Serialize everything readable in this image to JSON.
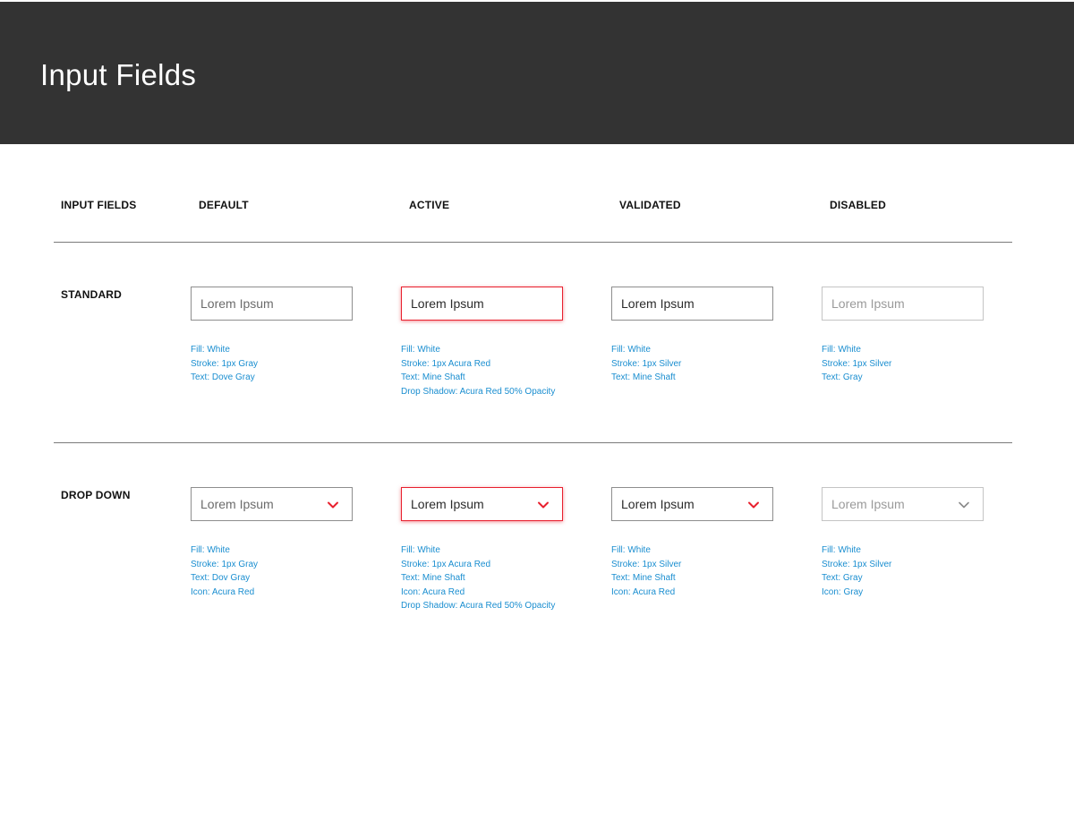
{
  "header": {
    "title": "Input Fields"
  },
  "columns": {
    "label": "INPUT FIELDS",
    "default": "DEFAULT",
    "active": "ACTIVE",
    "validated": "VALIDATED",
    "disabled": "DISABLED"
  },
  "colors": {
    "header_bg": "#333333",
    "acura_red": "#e8202e",
    "spec_text": "#1a8ed0",
    "gray_stroke": "#8e8e8e",
    "silver_stroke": "#c4c4c4"
  },
  "standard": {
    "label": "STANDARD",
    "default": {
      "value": "Lorem Ipsum",
      "specs": [
        "Fill: White",
        "Stroke: 1px Gray",
        "Text: Dove Gray"
      ]
    },
    "active": {
      "value": "Lorem Ipsum",
      "specs": [
        "Fill: White",
        "Stroke: 1px Acura Red",
        "Text: Mine Shaft",
        "Drop Shadow: Acura Red 50% Opacity"
      ]
    },
    "validated": {
      "value": "Lorem Ipsum",
      "specs": [
        "Fill: White",
        "Stroke: 1px Silver",
        "Text: Mine Shaft"
      ]
    },
    "disabled": {
      "value": "Lorem Ipsum",
      "specs": [
        "Fill: White",
        "Stroke: 1px Silver",
        "Text: Gray"
      ]
    }
  },
  "dropdown": {
    "label": "DROP DOWN",
    "icon": "chevron-down-icon",
    "default": {
      "value": "Lorem Ipsum",
      "icon_color": "#e8202e",
      "specs": [
        "Fill: White",
        "Stroke: 1px Gray",
        "Text: Dov Gray",
        "Icon: Acura Red"
      ]
    },
    "active": {
      "value": "Lorem Ipsum",
      "icon_color": "#e8202e",
      "specs": [
        "Fill: White",
        "Stroke: 1px Acura Red",
        "Text: Mine Shaft",
        "Icon: Acura Red",
        "Drop Shadow: Acura Red 50% Opacity"
      ]
    },
    "validated": {
      "value": "Lorem Ipsum",
      "icon_color": "#e8202e",
      "specs": [
        "Fill: White",
        "Stroke: 1px Silver",
        "Text: Mine Shaft",
        "Icon: Acura Red"
      ]
    },
    "disabled": {
      "value": "Lorem Ipsum",
      "icon_color": "#8a8a8a",
      "specs": [
        "Fill: White",
        "Stroke: 1px Silver",
        "Text: Gray",
        "Icon: Gray"
      ]
    }
  }
}
